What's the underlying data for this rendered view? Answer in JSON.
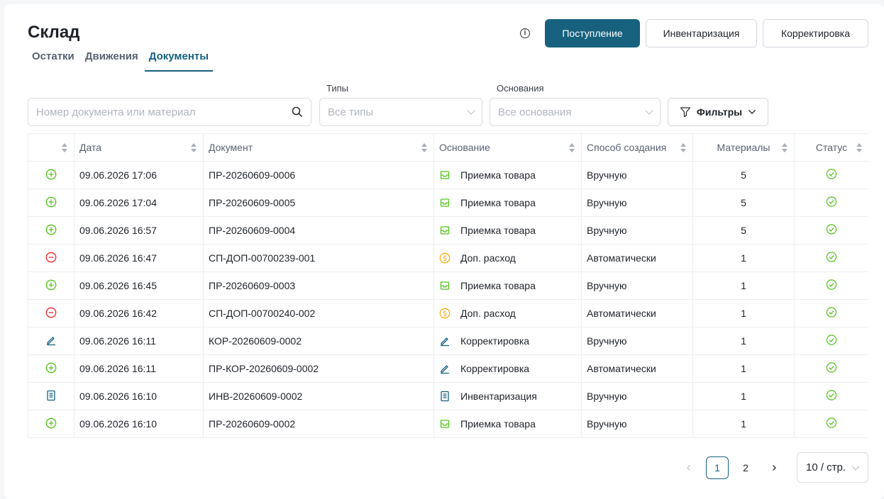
{
  "header": {
    "title": "Склад",
    "info_icon_glyph": "i",
    "tabs": [
      {
        "label": "Остатки",
        "active": false
      },
      {
        "label": "Движения",
        "active": false
      },
      {
        "label": "Документы",
        "active": true
      }
    ],
    "buttons": {
      "receipt": "Поступление",
      "inventory": "Инвентаризация",
      "correction": "Корректировка"
    }
  },
  "filters": {
    "search_placeholder": "Номер документа или материал",
    "types_label": "Типы",
    "types_placeholder": "Все типы",
    "basis_label": "Основания",
    "basis_placeholder": "Все основания",
    "filters_button": "Фильтры"
  },
  "table": {
    "columns": [
      "",
      "Дата",
      "Документ",
      "Основание",
      "Способ создания",
      "Материалы",
      "Статус"
    ],
    "rows": [
      {
        "kind": "plus",
        "date": "09.06.2026 17:06",
        "doc": "ПР-20260609-0006",
        "basis_icon": "inbox",
        "basis": "Приемка товара",
        "method": "Вручную",
        "materials": "5",
        "status": "ok"
      },
      {
        "kind": "plus",
        "date": "09.06.2026 17:04",
        "doc": "ПР-20260609-0005",
        "basis_icon": "inbox",
        "basis": "Приемка товара",
        "method": "Вручную",
        "materials": "5",
        "status": "ok"
      },
      {
        "kind": "plus",
        "date": "09.06.2026 16:57",
        "doc": "ПР-20260609-0004",
        "basis_icon": "inbox",
        "basis": "Приемка товара",
        "method": "Вручную",
        "materials": "5",
        "status": "ok"
      },
      {
        "kind": "minus",
        "date": "09.06.2026 16:47",
        "doc": "СП-ДОП-00700239-001",
        "basis_icon": "dollar",
        "basis": "Доп. расход",
        "method": "Автоматически",
        "materials": "1",
        "status": "ok"
      },
      {
        "kind": "plus",
        "date": "09.06.2026 16:45",
        "doc": "ПР-20260609-0003",
        "basis_icon": "inbox",
        "basis": "Приемка товара",
        "method": "Вручную",
        "materials": "1",
        "status": "ok"
      },
      {
        "kind": "minus",
        "date": "09.06.2026 16:42",
        "doc": "СП-ДОП-00700240-002",
        "basis_icon": "dollar",
        "basis": "Доп. расход",
        "method": "Автоматически",
        "materials": "1",
        "status": "ok"
      },
      {
        "kind": "edit",
        "date": "09.06.2026 16:11",
        "doc": "КОР-20260609-0002",
        "basis_icon": "edit",
        "basis": "Корректировка",
        "method": "Вручную",
        "materials": "1",
        "status": "ok"
      },
      {
        "kind": "plus",
        "date": "09.06.2026 16:11",
        "doc": "ПР-КОР-20260609-0002",
        "basis_icon": "edit",
        "basis": "Корректировка",
        "method": "Автоматически",
        "materials": "1",
        "status": "ok"
      },
      {
        "kind": "inventory",
        "date": "09.06.2026 16:10",
        "doc": "ИНВ-20260609-0002",
        "basis_icon": "inventory",
        "basis": "Инвентаризация",
        "method": "Вручную",
        "materials": "1",
        "status": "ok"
      },
      {
        "kind": "plus",
        "date": "09.06.2026 16:10",
        "doc": "ПР-20260609-0002",
        "basis_icon": "inbox",
        "basis": "Приемка товара",
        "method": "Вручную",
        "materials": "1",
        "status": "ok"
      }
    ]
  },
  "pagination": {
    "pages": [
      "1",
      "2"
    ],
    "current": "1",
    "page_size": "10 / стр."
  },
  "colors": {
    "primary": "#17617f",
    "plus": "#52c41a",
    "minus": "#f5222d",
    "dollar": "#faad14",
    "blue_icon": "#17617f",
    "status_ok": "#52c41a"
  }
}
